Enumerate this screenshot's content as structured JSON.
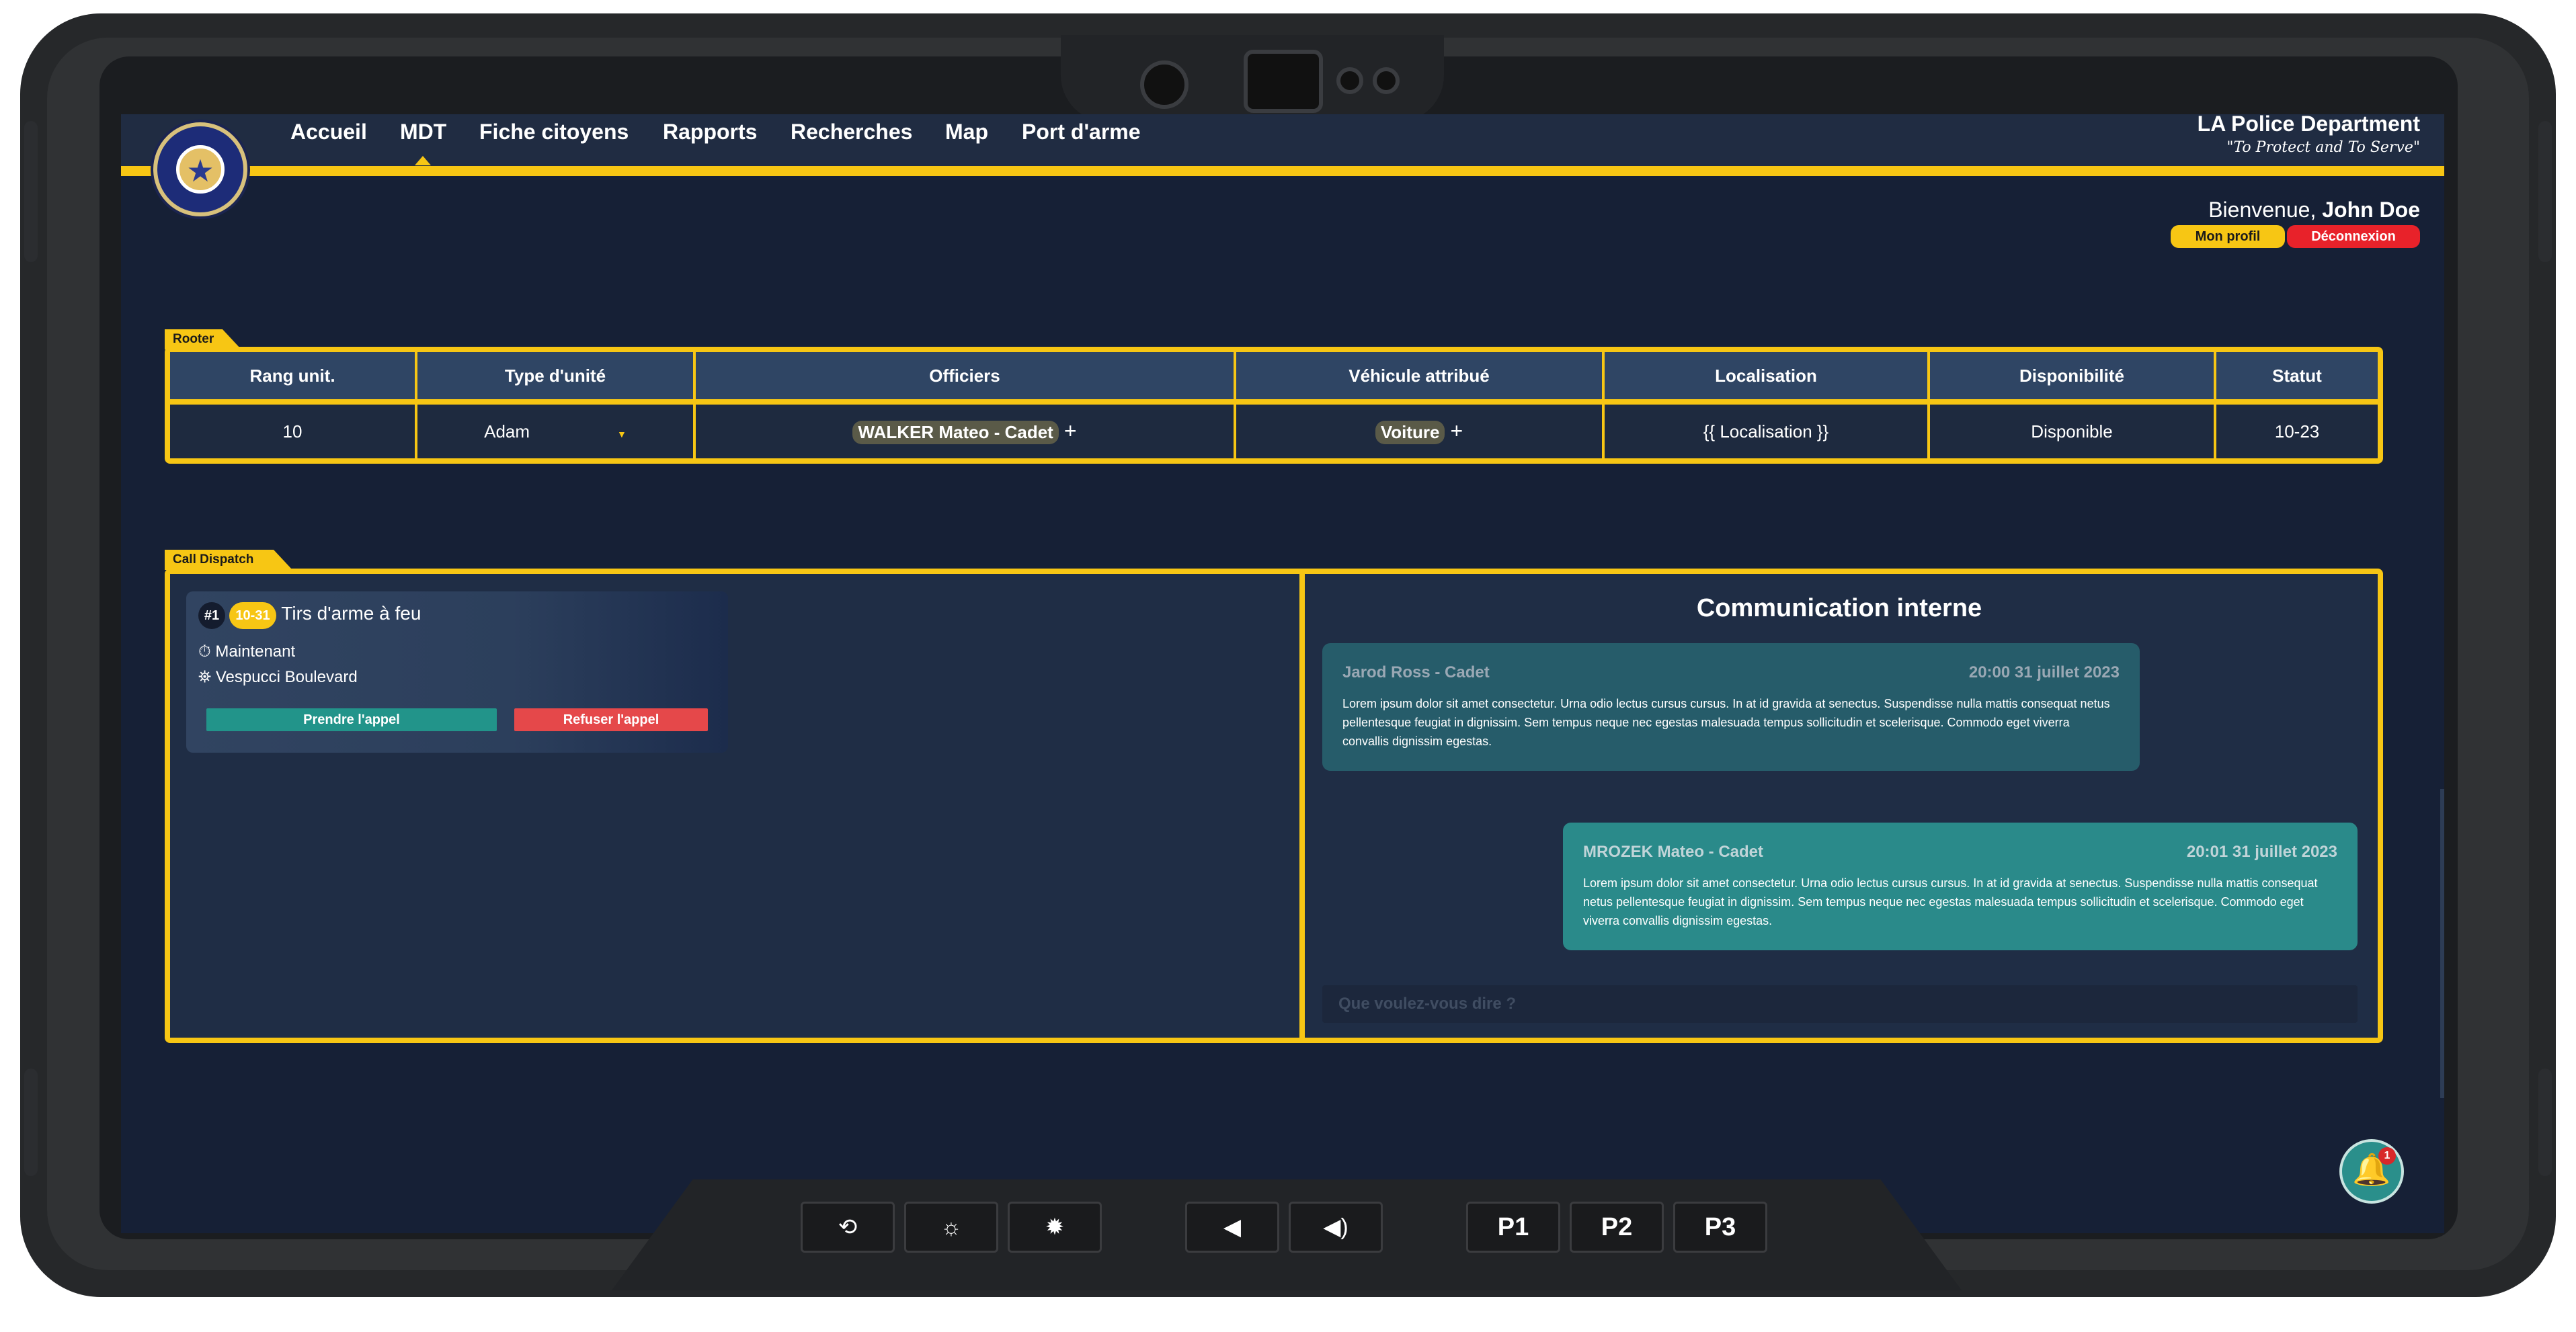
{
  "nav": {
    "items": [
      "Accueil",
      "MDT",
      "Fiche citoyens",
      "Rapports",
      "Recherches",
      "Map",
      "Port d'arme"
    ],
    "active": "MDT"
  },
  "department": {
    "name": "LA Police Department",
    "motto": "\"To Protect and To Serve\""
  },
  "user": {
    "greeting": "Bienvenue,",
    "name": "John Doe",
    "profile_label": "Mon profil",
    "logout_label": "Déconnexion"
  },
  "rooter": {
    "tab_label": "Rooter",
    "columns": [
      "Rang unit.",
      "Type d'unité",
      "Officiers",
      "Véhicule attribué",
      "Localisation",
      "Disponibilité",
      "Statut"
    ],
    "row": {
      "rank": "10",
      "unit_type": "Adam",
      "officer": "WALKER Mateo - Cadet",
      "vehicle": "Voiture",
      "location": "{{ Localisation }}",
      "availability": "Disponible",
      "status": "10-23"
    }
  },
  "dispatch": {
    "tab_label": "Call Dispatch",
    "call": {
      "number": "#1",
      "code": "10-31",
      "title": "Tirs d'arme à feu",
      "time": "Maintenant",
      "location": "Vespucci Boulevard",
      "accept_label": "Prendre l'appel",
      "refuse_label": "Refuser l'appel"
    },
    "comm_title": "Communication interne",
    "messages": [
      {
        "author": "Jarod Ross - Cadet",
        "time": "20:00 31 juillet 2023",
        "text": "Lorem ipsum dolor sit amet consectetur. Urna odio lectus cursus cursus. In at id gravida at senectus. Suspendisse nulla mattis consequat netus pellentesque feugiat in dignissim. Sem tempus neque nec egestas malesuada tempus sollicitudin et scelerisque. Commodo eget viverra convallis dignissim egestas."
      },
      {
        "author": "MROZEK Mateo - Cadet",
        "time": "20:01 31 juillet 2023",
        "text": "Lorem ipsum dolor sit amet consectetur. Urna odio lectus cursus cursus. In at id gravida at senectus. Suspendisse nulla mattis consequat netus pellentesque feugiat in dignissim. Sem tempus neque nec egestas malesuada tempus sollicitudin et scelerisque. Commodo eget viverra convallis dignissim egestas."
      }
    ],
    "input_placeholder": "Que voulez-vous dire ?"
  },
  "notifications": {
    "count": "1"
  },
  "hardware_buttons": {
    "p1": "P1",
    "p2": "P2",
    "p3": "P3"
  },
  "colors": {
    "accent": "#f7c614",
    "background": "#162036",
    "teal": "#22948a",
    "danger": "#e5484a"
  }
}
